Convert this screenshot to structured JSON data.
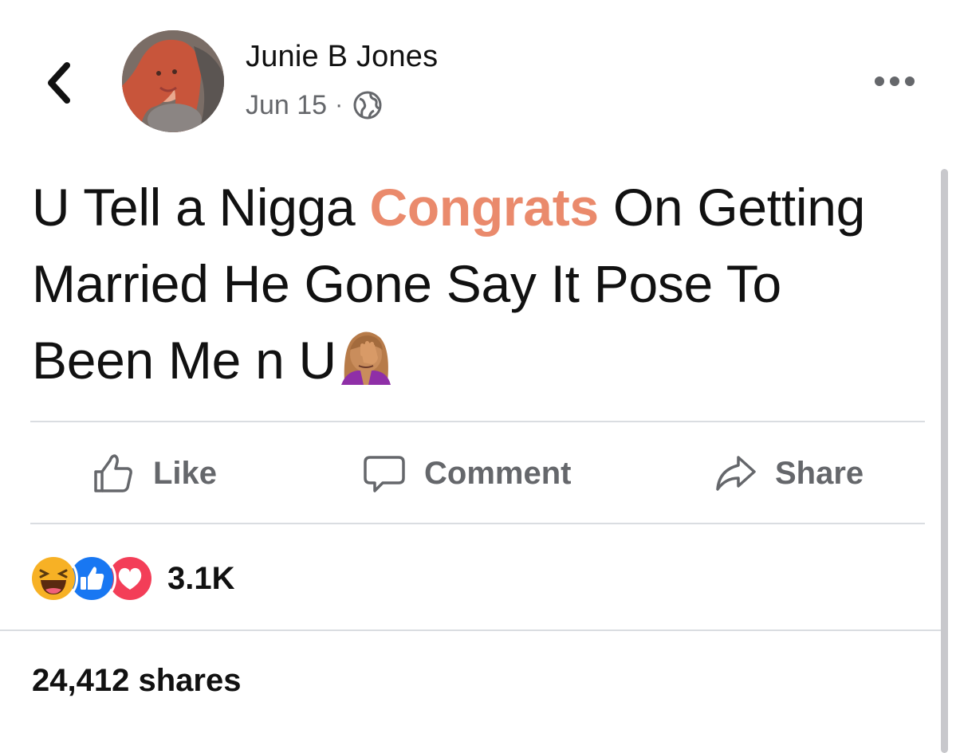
{
  "header": {
    "author_name": "Junie B Jones",
    "date": "Jun 15",
    "separator": "·",
    "privacy_icon": "globe-icon",
    "back_icon": "chevron-left-icon",
    "more_icon": "more-horizontal-icon"
  },
  "post": {
    "text_part1": "U Tell a Nigga ",
    "text_highlight": "Congrats",
    "text_part2": " On Getting Married He Gone Say It Pose To Been Me n U",
    "emoji_icon": "woman-facepalming-icon",
    "highlight_color": "#ea8a6c"
  },
  "actions": {
    "like_label": "Like",
    "comment_label": "Comment",
    "share_label": "Share"
  },
  "reactions": {
    "icons": [
      "haha-icon",
      "like-reaction-icon",
      "love-reaction-icon"
    ],
    "count": "3.1K"
  },
  "shares": {
    "label": "24,412 shares"
  },
  "colors": {
    "secondary_text": "#65676b",
    "divider": "#dadde1",
    "like_blue": "#1877f2",
    "love_red": "#f33e58",
    "haha_yellow": "#f7b125"
  }
}
